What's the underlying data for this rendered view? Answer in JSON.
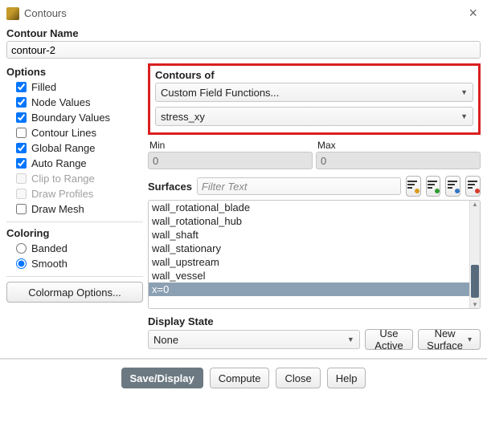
{
  "window": {
    "title": "Contours"
  },
  "contour_name": {
    "label": "Contour Name",
    "value": "contour-2"
  },
  "options": {
    "header": "Options",
    "items": [
      {
        "label": "Filled",
        "checked": true,
        "enabled": true
      },
      {
        "label": "Node Values",
        "checked": true,
        "enabled": true
      },
      {
        "label": "Boundary Values",
        "checked": true,
        "enabled": true
      },
      {
        "label": "Contour Lines",
        "checked": false,
        "enabled": true
      },
      {
        "label": "Global Range",
        "checked": true,
        "enabled": true
      },
      {
        "label": "Auto Range",
        "checked": true,
        "enabled": true
      },
      {
        "label": "Clip to Range",
        "checked": false,
        "enabled": false
      },
      {
        "label": "Draw Profiles",
        "checked": false,
        "enabled": false
      },
      {
        "label": "Draw Mesh",
        "checked": false,
        "enabled": true
      }
    ]
  },
  "coloring": {
    "header": "Coloring",
    "items": [
      {
        "label": "Banded",
        "selected": false
      },
      {
        "label": "Smooth",
        "selected": true
      }
    ]
  },
  "colormap_button": "Colormap Options...",
  "contours_of": {
    "header": "Contours of",
    "primary": "Custom Field Functions...",
    "secondary": "stress_xy"
  },
  "range": {
    "min_label": "Min",
    "max_label": "Max",
    "min_value": "0",
    "max_value": "0"
  },
  "surfaces": {
    "label": "Surfaces",
    "filter_placeholder": "Filter Text",
    "items": [
      {
        "label": "wall_rotational_blade",
        "selected": false
      },
      {
        "label": "wall_rotational_hub",
        "selected": false
      },
      {
        "label": "wall_shaft",
        "selected": false
      },
      {
        "label": "wall_stationary",
        "selected": false
      },
      {
        "label": "wall_upstream",
        "selected": false
      },
      {
        "label": "wall_vessel",
        "selected": false
      },
      {
        "label": "x=0",
        "selected": true
      }
    ]
  },
  "display_state": {
    "header": "Display State",
    "value": "None",
    "use_active": "Use Active",
    "new_surface": "New Surface"
  },
  "buttons": {
    "save": "Save/Display",
    "compute": "Compute",
    "close": "Close",
    "help": "Help"
  }
}
